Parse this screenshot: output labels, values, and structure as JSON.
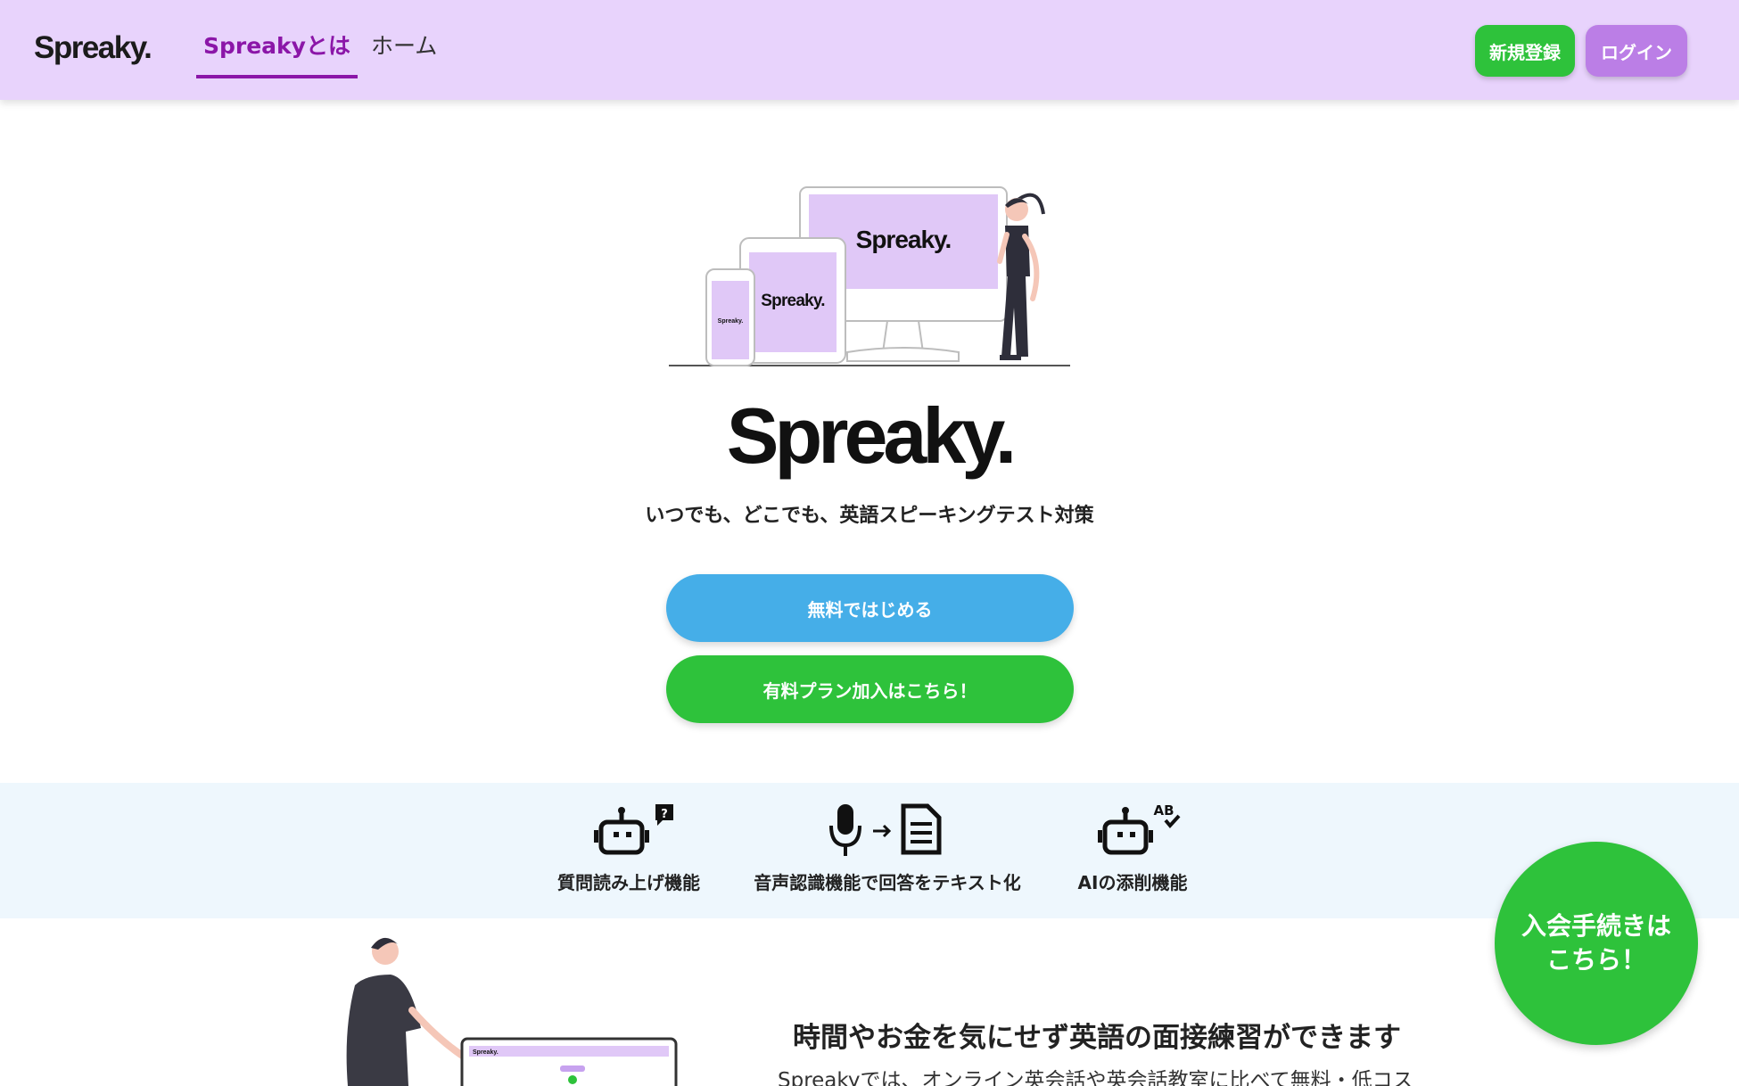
{
  "header": {
    "brand": "Spreaky.",
    "nav": [
      {
        "label": "Spreakyとは",
        "active": true
      },
      {
        "label": "ホーム",
        "active": false
      }
    ],
    "signup_label": "新規登録",
    "login_label": "ログイン"
  },
  "hero": {
    "illustration": {
      "monitor_logo": "Spreaky.",
      "tablet_logo": "Spreaky.",
      "phone_logo": "Spreaky."
    },
    "logo": "Spreaky.",
    "tagline": "いつでも、どこでも、英語スピーキングテスト対策",
    "cta_free": "無料ではじめる",
    "cta_paid": "有料プラン加入はこちら！"
  },
  "features": [
    {
      "icon": "robot-question-icon",
      "label": "質問読み上げ機能"
    },
    {
      "icon": "mic-to-text-icon",
      "label": "音声認識機能で回答をテキスト化"
    },
    {
      "icon": "robot-correction-icon",
      "label": "AIの添削機能",
      "icon_badge": "AB"
    }
  ],
  "join": {
    "label_line1": "入会手続きは",
    "label_line2": "こちら！"
  },
  "section": {
    "title": "時間やお金を気にせず英語の面接練習ができます",
    "body": "Spreakyでは、オンライン英会話や英会話教室に比べて無料・低コス",
    "illustration_logo": "Spreaky."
  },
  "colors": {
    "header_bg": "#e8d3fc",
    "accent_purple": "#8b16a8",
    "green": "#2ec23b",
    "lavender": "#bb7ee6",
    "blue": "#45aee8",
    "band_bg": "#eef7fd"
  }
}
